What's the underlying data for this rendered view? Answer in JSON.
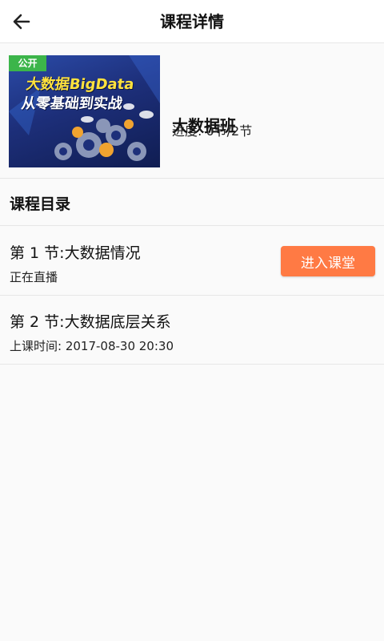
{
  "header": {
    "title": "课程详情",
    "back_icon": "arrow-left-icon"
  },
  "course": {
    "cover": {
      "badge": "公开",
      "line1": "大数据BigData",
      "line2": "从零基础到实战"
    },
    "name": "大数据班",
    "progress": "进度: 0节/2节"
  },
  "catalog": {
    "title": "课程目录",
    "lessons": [
      {
        "title": "第 1 节:大数据情况",
        "sub": "正在直播",
        "button": "进入课堂"
      },
      {
        "title": "第 2 节:大数据底层关系",
        "sub": "上课时间: 2017-08-30 20:30"
      }
    ]
  },
  "colors": {
    "accent": "#ff7a44",
    "badge": "#3cb54a",
    "cover_yellow": "#ffe23d"
  }
}
